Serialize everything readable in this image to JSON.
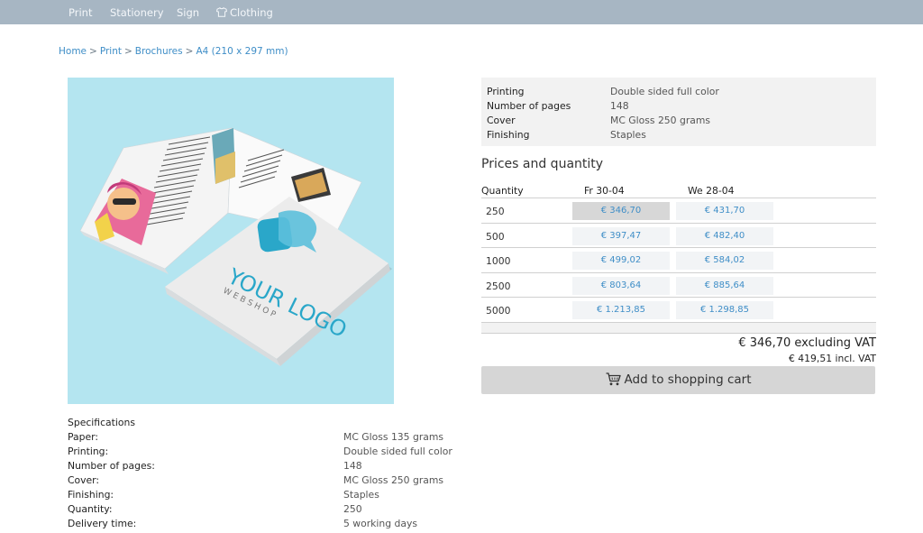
{
  "nav": {
    "items": [
      {
        "label": "Print"
      },
      {
        "label": "Stationery"
      },
      {
        "label": "Sign"
      },
      {
        "label": "Clothing",
        "icon": "tshirt-icon"
      }
    ]
  },
  "breadcrumb": [
    {
      "label": "Home"
    },
    {
      "label": "Print"
    },
    {
      "label": "Brochures"
    },
    {
      "label": "A4 (210 x 297 mm)"
    }
  ],
  "breadcrumb_separator": ">",
  "product_image": {
    "logo_line1": "YOUR LOGO",
    "logo_line2": "WEBSHOP",
    "colors": {
      "background": "#b4e5f0",
      "logo": "#2aa7c9"
    }
  },
  "summary": [
    {
      "label": "Printing",
      "value": "Double sided full color"
    },
    {
      "label": "Number of pages",
      "value": "148"
    },
    {
      "label": "Cover",
      "value": "MC Gloss 250 grams"
    },
    {
      "label": "Finishing",
      "value": "Staples"
    }
  ],
  "prices": {
    "title": "Prices and quantity",
    "headers": [
      "Quantity",
      "Fr 30-04",
      "We 28-04"
    ],
    "rows": [
      {
        "qty": "250",
        "p1": "€ 346,70",
        "p2": "€ 431,70"
      },
      {
        "qty": "500",
        "p1": "€ 397,47",
        "p2": "€ 482,40"
      },
      {
        "qty": "1000",
        "p1": "€ 499,02",
        "p2": "€ 584,02"
      },
      {
        "qty": "2500",
        "p1": "€ 803,64",
        "p2": "€ 885,64"
      },
      {
        "qty": "5000",
        "p1": "€ 1.213,85",
        "p2": "€ 1.298,85"
      }
    ],
    "selected": {
      "row": 0,
      "column": 1
    }
  },
  "total": {
    "excl": "€ 346,70 excluding VAT",
    "incl": "€ 419,51 incl. VAT"
  },
  "cart_button": {
    "label": "Add to shopping cart",
    "icon": "shopping-cart-icon"
  },
  "specifications": {
    "title": "Specifications",
    "rows": [
      {
        "label": "Paper:",
        "value": "MC Gloss 135 grams"
      },
      {
        "label": "Printing:",
        "value": "Double sided full color"
      },
      {
        "label": "Number of pages:",
        "value": "148"
      },
      {
        "label": "Cover:",
        "value": "MC Gloss 250 grams"
      },
      {
        "label": "Finishing:",
        "value": "Staples"
      },
      {
        "label": "Quantity:",
        "value": "250"
      },
      {
        "label": "Delivery time:",
        "value": "5 working days"
      }
    ]
  },
  "colors": {
    "nav_bg": "#a7b6c3",
    "link": "#3f8ec7",
    "panel_bg": "#f2f2f2",
    "selected_price_bg": "#d7d7d7",
    "button_bg": "#d6d6d6"
  }
}
